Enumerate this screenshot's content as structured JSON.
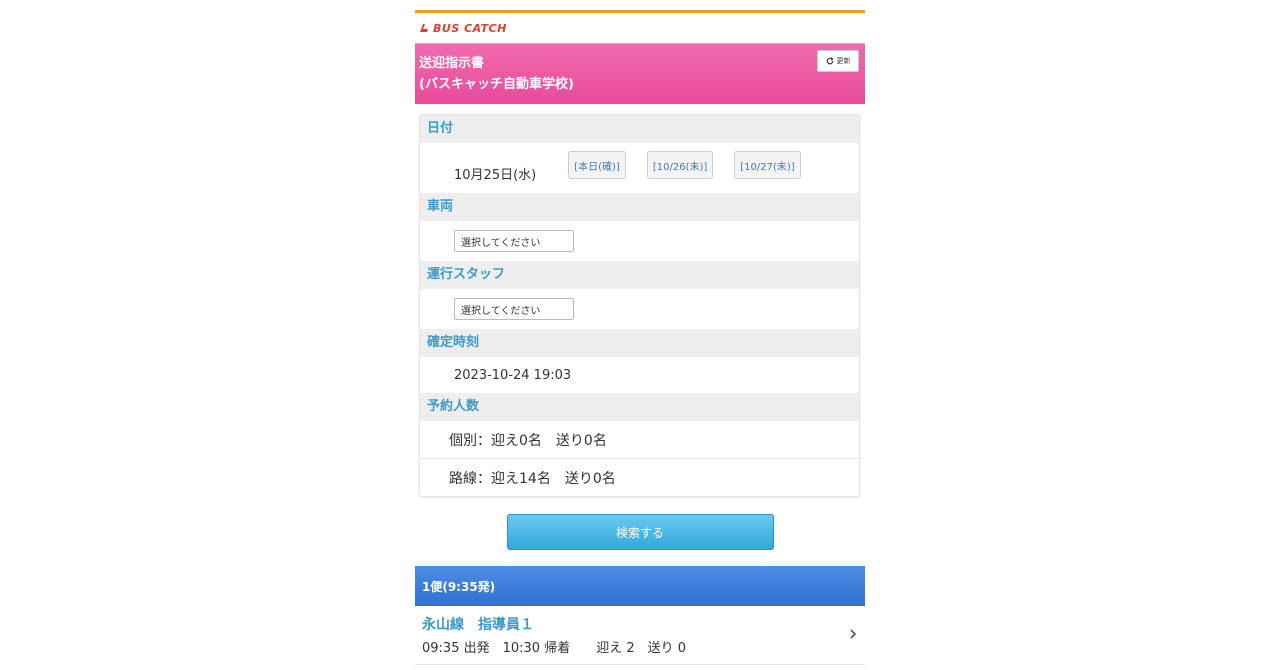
{
  "brand": {
    "logo_text": "BUS CATCH"
  },
  "header": {
    "title_line1": "送迎指示書",
    "title_line2": "(バスキャッチ自動車学校)",
    "refresh_label": "更新"
  },
  "date_section": {
    "label": "日付",
    "current_date": "10月25日(水)",
    "buttons": [
      "[本日(確)]",
      "[10/26(未)]",
      "[10/27(未)]"
    ]
  },
  "vehicle_section": {
    "label": "車両",
    "select_value": "選択してください"
  },
  "staff_section": {
    "label": "運行スタッフ",
    "select_value": "選択してください"
  },
  "confirmed_section": {
    "label": "確定時刻",
    "value": "2023-10-24 19:03"
  },
  "reservation_section": {
    "label": "予約人数",
    "rows": [
      "個別：迎え0名　送り0名",
      "路線：迎え14名　送り0名"
    ]
  },
  "search_button": "検索する",
  "runs": [
    {
      "header": "1便(9:35発)",
      "route": "永山線",
      "instructor": "指導員１",
      "info": "09:35 出発　10:30 帰着　　迎え 2　送り 0"
    }
  ],
  "colors": {
    "header_pink": "#ee5ea6",
    "accent_blue": "#3a9ac9",
    "run_header_blue": "#3b7fda",
    "search_button": "#4bb8e6",
    "top_border": "#f0a01e"
  }
}
